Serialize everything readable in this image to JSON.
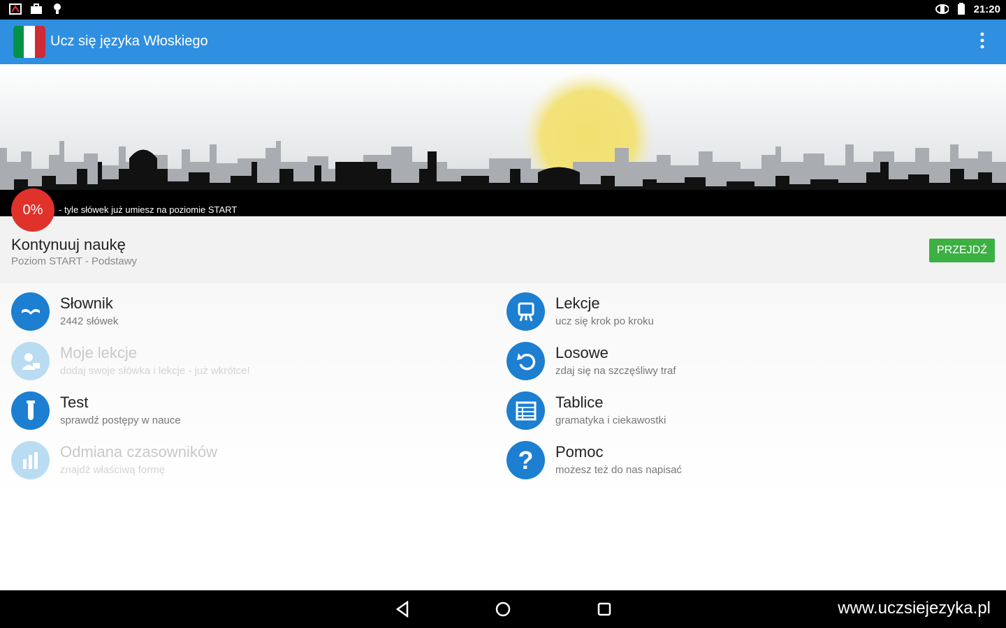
{
  "status_bar": {
    "time": "21:20",
    "left_icons": [
      "notification-icon",
      "briefcase-icon",
      "bulb-icon"
    ],
    "right_icons": [
      "rotate-icon",
      "battery-icon"
    ]
  },
  "app_bar": {
    "title": "Ucz się języka Włoskiego",
    "flag_colors": [
      "#009246",
      "#ffffff",
      "#ce2b37"
    ],
    "accent": "#2f8fe0"
  },
  "banner": {
    "progress": "0%",
    "progress_fraction": 0,
    "caption": "- tyle słówek już umiesz na poziomie START"
  },
  "continue": {
    "title": "Kontynuuj naukę",
    "subtitle": "Poziom START - Podstawy",
    "button": "PRZEJDŹ"
  },
  "menu": {
    "left": [
      {
        "label": "Słownik",
        "desc": "2442 słówek",
        "icon": "book-icon",
        "enabled": true
      },
      {
        "label": "Moje lekcje",
        "desc": "dodaj swoje słówka i lekcje - już wkrótce!",
        "icon": "user-lesson-icon",
        "enabled": false
      },
      {
        "label": "Test",
        "desc": "sprawdź postępy w nauce",
        "icon": "test-tube-icon",
        "enabled": true
      },
      {
        "label": "Odmiana czasowników",
        "desc": "znajdź właściwą formę",
        "icon": "bars-icon",
        "enabled": false
      }
    ],
    "right": [
      {
        "label": "Lekcje",
        "desc": "ucz się krok po kroku",
        "icon": "easel-icon",
        "enabled": true
      },
      {
        "label": "Losowe",
        "desc": "zdaj się na szczęśliwy traf",
        "icon": "undo-icon",
        "enabled": true
      },
      {
        "label": "Tablice",
        "desc": "gramatyka i ciekawostki",
        "icon": "table-icon",
        "enabled": true
      },
      {
        "label": "Pomoc",
        "desc": "możesz też do nas napisać",
        "icon": "question-icon",
        "enabled": true
      }
    ]
  },
  "nav_bar": {
    "watermark": "www.uczsiejezyka.pl"
  }
}
